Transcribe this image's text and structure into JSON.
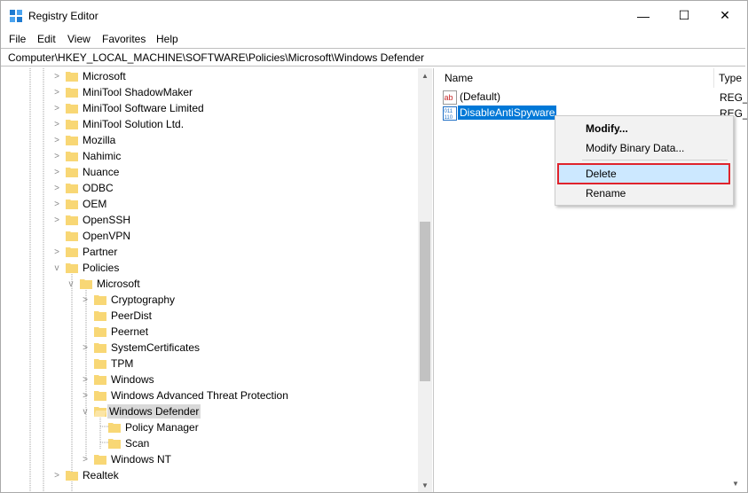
{
  "window": {
    "title": "Registry Editor",
    "minimize_glyph": "—",
    "maximize_glyph": "☐",
    "close_glyph": "✕"
  },
  "menu": [
    "File",
    "Edit",
    "View",
    "Favorites",
    "Help"
  ],
  "address": "Computer\\HKEY_LOCAL_MACHINE\\SOFTWARE\\Policies\\Microsoft\\Windows Defender",
  "tree": [
    {
      "label": "Microsoft",
      "expander": ">"
    },
    {
      "label": "MiniTool ShadowMaker",
      "expander": ">"
    },
    {
      "label": "MiniTool Software Limited",
      "expander": ">"
    },
    {
      "label": "MiniTool Solution Ltd.",
      "expander": ">"
    },
    {
      "label": "Mozilla",
      "expander": ">"
    },
    {
      "label": "Nahimic",
      "expander": ">"
    },
    {
      "label": "Nuance",
      "expander": ">"
    },
    {
      "label": "ODBC",
      "expander": ">"
    },
    {
      "label": "OEM",
      "expander": ">"
    },
    {
      "label": "OpenSSH",
      "expander": ">"
    },
    {
      "label": "OpenVPN",
      "expander": ""
    },
    {
      "label": "Partner",
      "expander": ">"
    },
    {
      "label": "Policies",
      "expander": "v"
    },
    {
      "label": "Microsoft",
      "expander": "v"
    },
    {
      "label": "Cryptography",
      "expander": ">"
    },
    {
      "label": "PeerDist",
      "expander": ""
    },
    {
      "label": "Peernet",
      "expander": ""
    },
    {
      "label": "SystemCertificates",
      "expander": ">"
    },
    {
      "label": "TPM",
      "expander": ""
    },
    {
      "label": "Windows",
      "expander": ">"
    },
    {
      "label": "Windows Advanced Threat Protection",
      "expander": ">"
    },
    {
      "label": "Windows Defender",
      "expander": "v",
      "selected": true
    },
    {
      "label": "Policy Manager",
      "expander": ""
    },
    {
      "label": "Scan",
      "expander": ""
    },
    {
      "label": "Windows NT",
      "expander": ">"
    },
    {
      "label": "Realtek",
      "expander": ">"
    }
  ],
  "values_pane": {
    "col_name": "Name",
    "col_type": "Type",
    "rows": [
      {
        "name": "(Default)",
        "type": "REG_SZ",
        "icon": "string-value-icon"
      },
      {
        "name": "DisableAntiSpyware",
        "type": "REG_DWORD",
        "icon": "binary-value-icon",
        "selected": true
      }
    ]
  },
  "context_menu": {
    "items": [
      "Modify...",
      "Modify Binary Data...",
      "Delete",
      "Rename"
    ],
    "highlighted": "Delete",
    "highlight_color": "#e0232c"
  },
  "colors": {
    "selection": "#0078d7",
    "folder": "#f8d775"
  }
}
